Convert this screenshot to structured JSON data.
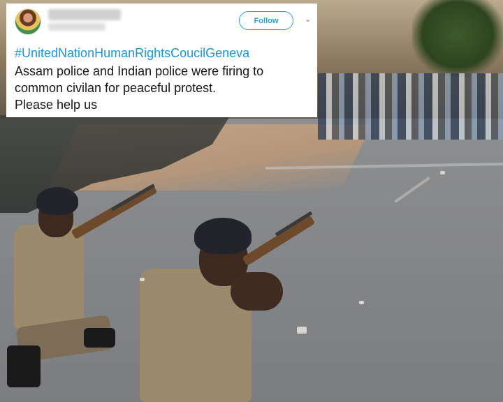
{
  "tweet": {
    "follow_label": "Follow",
    "hashtag": "#UnitedNationHumanRightsCoucilGeneva",
    "lines": [
      "Assam police and Indian police were firing to",
      "common civilan for peaceful protest.",
      "Please help us"
    ],
    "icons": {
      "avatar": "profile-avatar",
      "menu": "chevron-down-icon"
    },
    "colors": {
      "accent": "#1da1f2",
      "link": "#1b95e0",
      "text": "#14171a"
    }
  }
}
